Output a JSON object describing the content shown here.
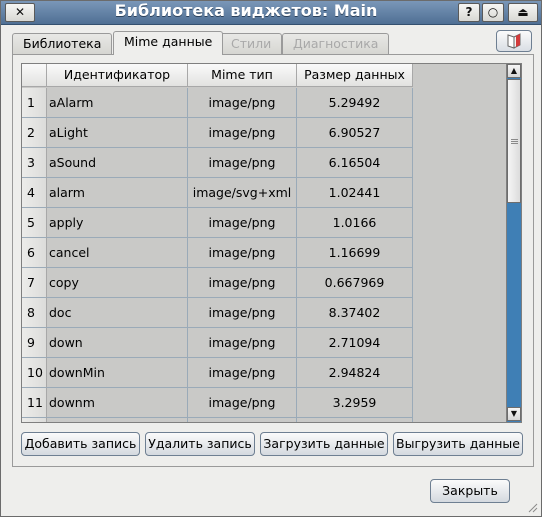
{
  "window": {
    "title": "Библиотека виджетов: Main",
    "buttons": {
      "close": "✕",
      "help": "?",
      "minimize": "○",
      "maximize": "⏏"
    }
  },
  "tabs": [
    {
      "label": "Библиотека",
      "state": "normal"
    },
    {
      "label": "Mime данные",
      "state": "active"
    },
    {
      "label": "Стили",
      "state": "disabled"
    },
    {
      "label": "Диагностика",
      "state": "disabled"
    }
  ],
  "table": {
    "columns": [
      "Идентификатор",
      "Mime тип",
      "Размер данных"
    ],
    "rows": [
      {
        "n": "1",
        "id": "aAlarm",
        "mime": "image/png",
        "size": "5.29492"
      },
      {
        "n": "2",
        "id": "aLight",
        "mime": "image/png",
        "size": "6.90527"
      },
      {
        "n": "3",
        "id": "aSound",
        "mime": "image/png",
        "size": "6.16504"
      },
      {
        "n": "4",
        "id": "alarm",
        "mime": "image/svg+xml",
        "size": "1.02441"
      },
      {
        "n": "5",
        "id": "apply",
        "mime": "image/png",
        "size": "1.0166"
      },
      {
        "n": "6",
        "id": "cancel",
        "mime": "image/png",
        "size": "1.16699"
      },
      {
        "n": "7",
        "id": "copy",
        "mime": "image/png",
        "size": "0.667969"
      },
      {
        "n": "8",
        "id": "doc",
        "mime": "image/png",
        "size": "8.37402"
      },
      {
        "n": "9",
        "id": "down",
        "mime": "image/png",
        "size": "2.71094"
      },
      {
        "n": "10",
        "id": "downMin",
        "mime": "image/png",
        "size": "2.94824"
      },
      {
        "n": "11",
        "id": "downm",
        "mime": "image/png",
        "size": "3.2959"
      },
      {
        "n": "",
        "id": "",
        "mime": "",
        "size": ""
      }
    ]
  },
  "actions": {
    "add": "Добавить запись",
    "delete": "Удалить запись",
    "load": "Загрузить данные",
    "unload": "Выгрузить данные"
  },
  "footer": {
    "close": "Закрыть"
  },
  "icons": {
    "corner_button": "book-icon",
    "resize": "resize-grip-icon"
  },
  "colors": {
    "titlebar": "#5e7ea3",
    "scrollbar_track": "#3f7fb5",
    "table_bg": "#c9c9c7"
  }
}
